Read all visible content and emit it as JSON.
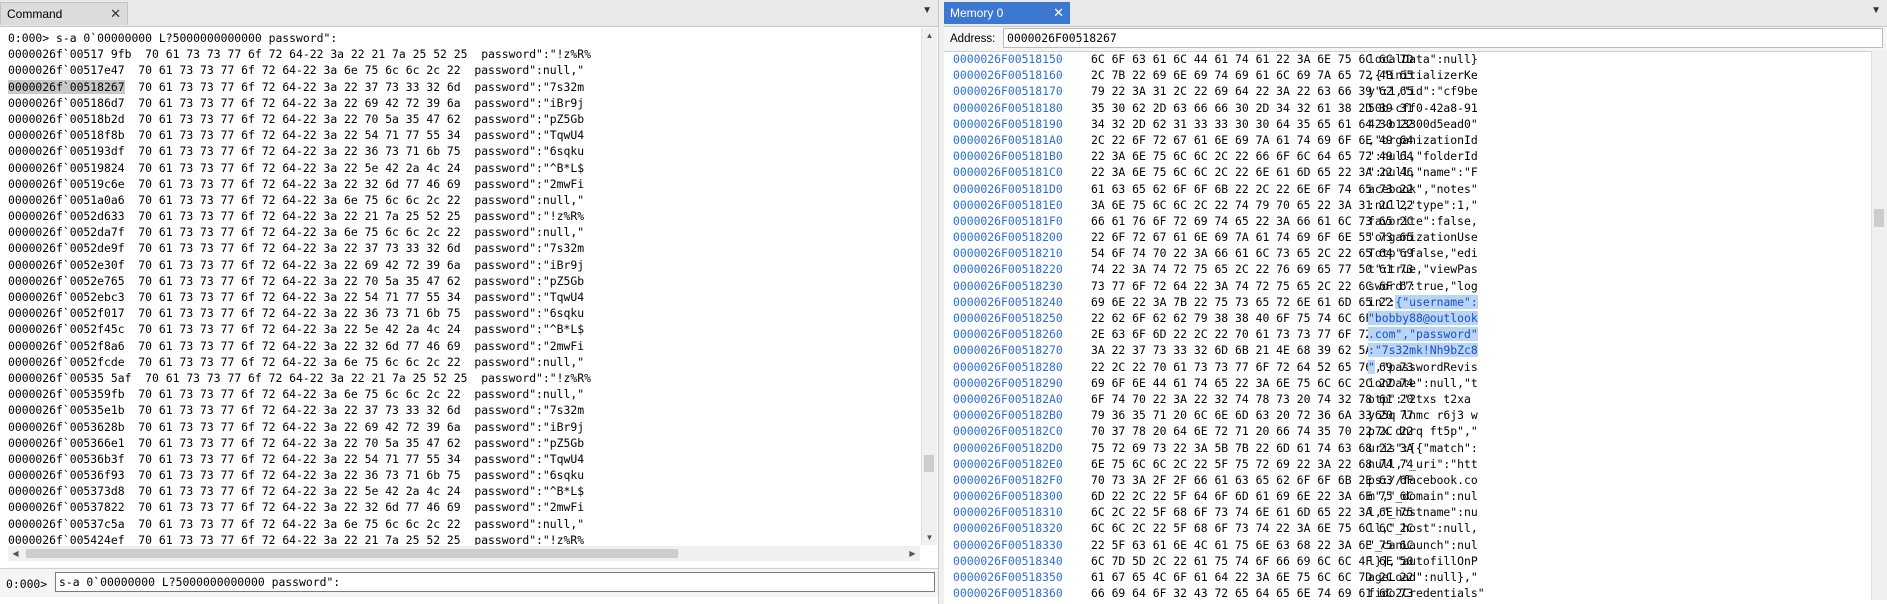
{
  "command_pane": {
    "tab_label": "Command",
    "history": [
      "0:000> s-a 0`00000000 L?5000000000000 password\":",
      "0000026f`00517 9fb  70 61 73 73 77 6f 72 64-22 3a 22 21 7a 25 52 25  password\":\"!z%R%",
      "0000026f`00517e47  70 61 73 73 77 6f 72 64-22 3a 6e 75 6c 6c 2c 22  password\":null,\"",
      "0000026f`00518267  70 61 73 73 77 6f 72 64-22 3a 22 37 73 33 32 6d  password\":\"7s32m",
      "0000026f`005186d7  70 61 73 73 77 6f 72 64-22 3a 22 69 42 72 39 6a  password\":\"iBr9j",
      "0000026f`00518b2d  70 61 73 73 77 6f 72 64-22 3a 22 70 5a 35 47 62  password\":\"pZ5Gb",
      "0000026f`00518f8b  70 61 73 73 77 6f 72 64-22 3a 22 54 71 77 55 34  password\":\"TqwU4",
      "0000026f`005193df  70 61 73 73 77 6f 72 64-22 3a 22 36 73 71 6b 75  password\":\"6sqku",
      "0000026f`00519824  70 61 73 73 77 6f 72 64-22 3a 22 5e 42 2a 4c 24  password\":\"^B*L$",
      "0000026f`00519c6e  70 61 73 73 77 6f 72 64-22 3a 22 32 6d 77 46 69  password\":\"2mwFi",
      "0000026f`0051a0a6  70 61 73 73 77 6f 72 64-22 3a 6e 75 6c 6c 2c 22  password\":null,\"",
      "0000026f`0052d633  70 61 73 73 77 6f 72 64-22 3a 22 21 7a 25 52 25  password\":\"!z%R%",
      "0000026f`0052da7f  70 61 73 73 77 6f 72 64-22 3a 6e 75 6c 6c 2c 22  password\":null,\"",
      "0000026f`0052de9f  70 61 73 73 77 6f 72 64-22 3a 22 37 73 33 32 6d  password\":\"7s32m",
      "0000026f`0052e30f  70 61 73 73 77 6f 72 64-22 3a 22 69 42 72 39 6a  password\":\"iBr9j",
      "0000026f`0052e765  70 61 73 73 77 6f 72 64-22 3a 22 70 5a 35 47 62  password\":\"pZ5Gb",
      "0000026f`0052ebc3  70 61 73 73 77 6f 72 64-22 3a 22 54 71 77 55 34  password\":\"TqwU4",
      "0000026f`0052f017  70 61 73 73 77 6f 72 64-22 3a 22 36 73 71 6b 75  password\":\"6sqku",
      "0000026f`0052f45c  70 61 73 73 77 6f 72 64-22 3a 22 5e 42 2a 4c 24  password\":\"^B*L$",
      "0000026f`0052f8a6  70 61 73 73 77 6f 72 64-22 3a 22 32 6d 77 46 69  password\":\"2mwFi",
      "0000026f`0052fcde  70 61 73 73 77 6f 72 64-22 3a 6e 75 6c 6c 2c 22  password\":null,\"",
      "0000026f`00535 5af  70 61 73 73 77 6f 72 64-22 3a 22 21 7a 25 52 25  password\":\"!z%R%",
      "0000026f`005359fb  70 61 73 73 77 6f 72 64-22 3a 6e 75 6c 6c 2c 22  password\":null,\"",
      "0000026f`00535e1b  70 61 73 73 77 6f 72 64-22 3a 22 37 73 33 32 6d  password\":\"7s32m",
      "0000026f`0053628b  70 61 73 73 77 6f 72 64-22 3a 22 69 42 72 39 6a  password\":\"iBr9j",
      "0000026f`005366e1  70 61 73 73 77 6f 72 64-22 3a 22 70 5a 35 47 62  password\":\"pZ5Gb",
      "0000026f`00536b3f  70 61 73 73 77 6f 72 64-22 3a 22 54 71 77 55 34  password\":\"TqwU4",
      "0000026f`00536f93  70 61 73 73 77 6f 72 64-22 3a 22 36 73 71 6b 75  password\":\"6sqku",
      "0000026f`005373d8  70 61 73 73 77 6f 72 64-22 3a 22 5e 42 2a 4c 24  password\":\"^B*L$",
      "0000026f`00537822  70 61 73 73 77 6f 72 64-22 3a 22 32 6d 77 46 69  password\":\"2mwFi",
      "0000026f`00537c5a  70 61 73 73 77 6f 72 64-22 3a 6e 75 6c 6c 2c 22  password\":null,\"",
      "0000026f`005424ef  70 61 73 73 77 6f 72 64-22 3a 22 21 7a 25 52 25  password\":\"!z%R%"
    ],
    "highlighted_address": "0000026f`00518267",
    "prompt": "0:000>",
    "input_value": "s-a 0`00000000 L?5000000000000 password\":"
  },
  "memory_pane": {
    "tab_label": "Memory 0",
    "address_label": "Address:",
    "address_value": "0000026F00518267",
    "rows": [
      {
        "addr": "0000026F00518150",
        "bytes": "6C 6F 63 61 6C 44 61 74 61 22 3A 6E 75 6C 6C 7D",
        "ascii": "localData\":null}"
      },
      {
        "addr": "0000026F00518160",
        "bytes": "2C 7B 22 69 6E 69 74 69 61 6C 69 7A 65 72 4B 65",
        "ascii": ",{\"initializerKe"
      },
      {
        "addr": "0000026F00518170",
        "bytes": "79 22 3A 31 2C 22 69 64 22 3A 22 63 66 39 62 65",
        "ascii": "y\":1,\"id\":\"cf9be"
      },
      {
        "addr": "0000026F00518180",
        "bytes": "35 30 62 2D 63 66 66 30 2D 34 32 61 38 2D 39 31",
        "ascii": "50b-cff0-42a8-91"
      },
      {
        "addr": "0000026F00518190",
        "bytes": "34 32 2D 62 31 33 33 30 30 64 35 65 61 64 30 22",
        "ascii": "42-b13300d5ead0\""
      },
      {
        "addr": "0000026F005181A0",
        "bytes": "2C 22 6F 72 67 61 6E 69 7A 61 74 69 6F 6E 49 64",
        "ascii": ",\"organizationId"
      },
      {
        "addr": "0000026F005181B0",
        "bytes": "22 3A 6E 75 6C 6C 2C 22 66 6F 6C 64 65 72 49 64",
        "ascii": "\":null,\"folderId"
      },
      {
        "addr": "0000026F005181C0",
        "bytes": "22 3A 6E 75 6C 6C 2C 22 6E 61 6D 65 22 3A 22 46",
        "ascii": "\":null,\"name\":\"F"
      },
      {
        "addr": "0000026F005181D0",
        "bytes": "61 63 65 62 6F 6F 6B 22 2C 22 6E 6F 74 65 73 22",
        "ascii": "acebook\",\"notes\""
      },
      {
        "addr": "0000026F005181E0",
        "bytes": "3A 6E 75 6C 6C 2C 22 74 79 70 65 22 3A 31 2C 22",
        "ascii": ":null,\"type\":1,\""
      },
      {
        "addr": "0000026F005181F0",
        "bytes": "66 61 76 6F 72 69 74 65 22 3A 66 61 6C 73 65 2C",
        "ascii": "favorite\":false,"
      },
      {
        "addr": "0000026F00518200",
        "bytes": "22 6F 72 67 61 6E 69 7A 61 74 69 6F 6E 55 73 65",
        "ascii": "\"organizationUse"
      },
      {
        "addr": "0000026F00518210",
        "bytes": "54 6F 74 70 22 3A 66 61 6C 73 65 2C 22 65 64 69",
        "ascii": "Totp\":false,\"edi"
      },
      {
        "addr": "0000026F00518220",
        "bytes": "74 22 3A 74 72 75 65 2C 22 76 69 65 77 50 61 73",
        "ascii": "t\":true,\"viewPas"
      },
      {
        "addr": "0000026F00518230",
        "bytes": "73 77 6F 72 64 22 3A 74 72 75 65 2C 22 6C 6F 67",
        "ascii": "sword\":true,\"log"
      },
      {
        "addr": "0000026F00518240",
        "bytes": "69 6E 22 3A 7B 22 75 73 65 72 6E 61 6D 65 22 3A",
        "ascii": "in\":{\"username\":"
      },
      {
        "addr": "0000026F00518250",
        "bytes": "22 62 6F 62 62 79 38 38 40 6F 75 74 6C 6F 6F 6B",
        "ascii": "\"bobby88@outlook"
      },
      {
        "addr": "0000026F00518260",
        "bytes": "2E 63 6F 6D 22 2C 22 70 61 73 73 77 6F 72 64 22",
        "ascii": ".com\",\"password\""
      },
      {
        "addr": "0000026F00518270",
        "bytes": "3A 22 37 73 33 32 6D 6B 21 4E 68 39 62 5A 63 38",
        "ascii": ":\"7s32mk!Nh9bZc8"
      },
      {
        "addr": "0000026F00518280",
        "bytes": "22 2C 22 70 61 73 73 77 6F 72 64 52 65 76 69 73",
        "ascii": "\",\"passwordRevis"
      },
      {
        "addr": "0000026F00518290",
        "bytes": "69 6F 6E 44 61 74 65 22 3A 6E 75 6C 6C 2C 22 74",
        "ascii": "ionDate\":null,\"t"
      },
      {
        "addr": "0000026F005182A0",
        "bytes": "6F 74 70 22 3A 22 32 74 78 73 20 74 32 78 61 20",
        "ascii": "otp\":\"2txs t2xa "
      },
      {
        "addr": "0000026F005182B0",
        "bytes": "79 36 35 71 20 6C 6E 6D 63 20 72 36 6A 33 20 77",
        "ascii": "y65q lnmc r6j3 w"
      },
      {
        "addr": "0000026F005182C0",
        "bytes": "70 37 78 20 64 6E 72 71 20 66 74 35 70 22 2C 22",
        "ascii": "p7x dnrq ft5p\",\""
      },
      {
        "addr": "0000026F005182D0",
        "bytes": "75 72 69 73 22 3A 5B 7B 22 6D 61 74 63 68 22 3A",
        "ascii": "uris\":[{\"match\":"
      },
      {
        "addr": "0000026F005182E0",
        "bytes": "6E 75 6C 6C 2C 22 5F 75 72 69 22 3A 22 68 74 74",
        "ascii": "null,\"_uri\":\"htt"
      },
      {
        "addr": "0000026F005182F0",
        "bytes": "70 73 3A 2F 2F 66 61 63 65 62 6F 6F 6B 2E 63 6F",
        "ascii": "ps://facebook.co"
      },
      {
        "addr": "0000026F00518300",
        "bytes": "6D 22 2C 22 5F 64 6F 6D 61 69 6E 22 3A 6E 75 6C",
        "ascii": "m\",\"_domain\":nul"
      },
      {
        "addr": "0000026F00518310",
        "bytes": "6C 2C 22 5F 68 6F 73 74 6E 61 6D 65 22 3A 6E 75",
        "ascii": "l,\"_hostname\":nu"
      },
      {
        "addr": "0000026F00518320",
        "bytes": "6C 6C 2C 22 5F 68 6F 73 74 22 3A 6E 75 6C 6C 2C",
        "ascii": "ll,\"_host\":null,"
      },
      {
        "addr": "0000026F00518330",
        "bytes": "22 5F 63 61 6E 4C 61 75 6E 63 68 22 3A 6E 75 6C",
        "ascii": "\"_canLaunch\":nul"
      },
      {
        "addr": "0000026F00518340",
        "bytes": "6C 7D 5D 2C 22 61 75 74 6F 66 69 6C 6C 4F 6E 50",
        "ascii": "l}],\"autofillOnP"
      },
      {
        "addr": "0000026F00518350",
        "bytes": "61 67 65 4C 6F 61 64 22 3A 6E 75 6C 6C 7D 2C 22",
        "ascii": "ageLoad\":null},\""
      },
      {
        "addr": "0000026F00518360",
        "bytes": "66 69 64 6F 32 43 72 65 64 65 6E 74 69 61 6C 73",
        "ascii": "fido2Credentials\""
      }
    ]
  }
}
